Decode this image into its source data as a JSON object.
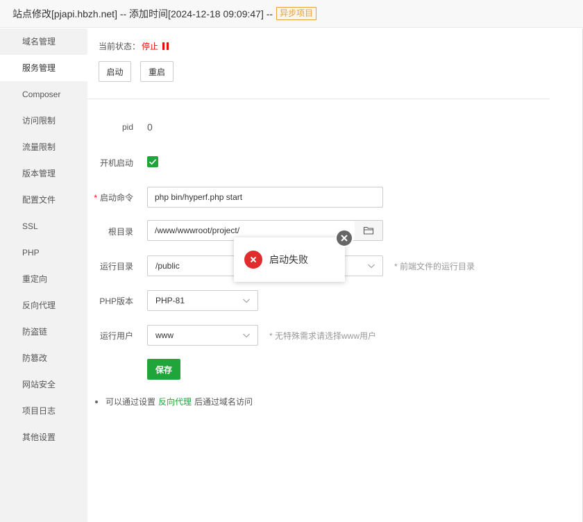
{
  "title": {
    "text": "站点修改[pjapi.hbzh.net] -- 添加时间[2024-12-18 09:09:47] --",
    "tag": "异步项目"
  },
  "sidebar": {
    "items": [
      {
        "label": "域名管理"
      },
      {
        "label": "服务管理"
      },
      {
        "label": "Composer"
      },
      {
        "label": "访问限制"
      },
      {
        "label": "流量限制"
      },
      {
        "label": "版本管理"
      },
      {
        "label": "配置文件"
      },
      {
        "label": "SSL"
      },
      {
        "label": "PHP"
      },
      {
        "label": "重定向"
      },
      {
        "label": "反向代理"
      },
      {
        "label": "防盗链"
      },
      {
        "label": "防篡改"
      },
      {
        "label": "网站安全"
      },
      {
        "label": "项目日志"
      },
      {
        "label": "其他设置"
      }
    ],
    "active_index": 1
  },
  "status": {
    "label": "当前状态：",
    "value": "停止",
    "color": "#ef0808"
  },
  "buttons": {
    "start": "启动",
    "restart": "重启",
    "save": "保存"
  },
  "form": {
    "pid_label": "pid",
    "pid_value": "0",
    "autostart_label": "开机启动",
    "autostart_checked": true,
    "command_label": "启动命令",
    "command_value": "php bin/hyperf.php start",
    "rootdir_label": "根目录",
    "rootdir_value": "/www/wwwroot/project/",
    "rundir_label": "运行目录",
    "rundir_value": "/public",
    "rundir_hint": "* 前端文件的运行目录",
    "php_label": "PHP版本",
    "php_value": "PHP-81",
    "user_label": "运行用户",
    "user_value": "www",
    "user_hint": "* 无特殊需求请选择www用户"
  },
  "tip": {
    "before": "可以通过设置",
    "link": "反向代理",
    "after": "后通过域名访问"
  },
  "toast": {
    "message": "启动失败",
    "icon": "error-icon"
  },
  "colors": {
    "accent": "#20a53a",
    "danger": "#ef0808",
    "tag": "#e6a23c"
  }
}
